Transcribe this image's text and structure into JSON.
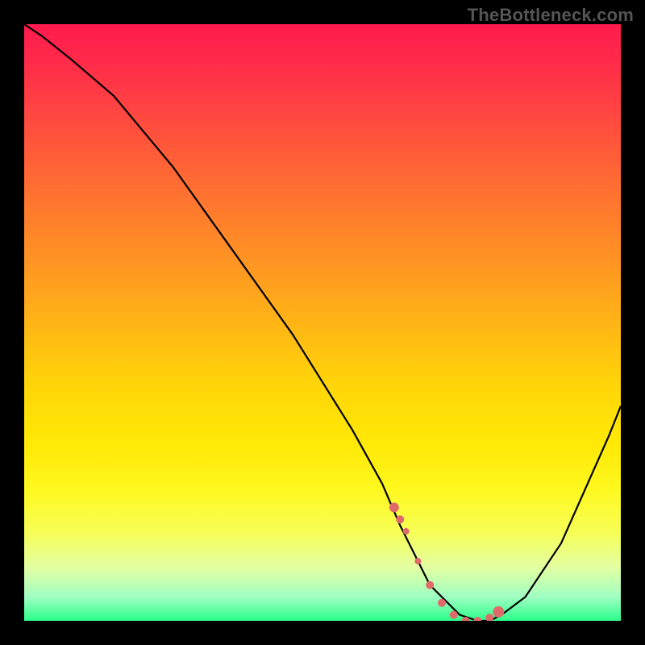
{
  "watermark": "TheBottleneck.com",
  "chart_data": {
    "type": "line",
    "title": "",
    "xlabel": "",
    "ylabel": "",
    "xlim": [
      0,
      100
    ],
    "ylim": [
      0,
      100
    ],
    "series": [
      {
        "name": "bottleneck-curve",
        "x": [
          0,
          3,
          8,
          15,
          25,
          35,
          45,
          55,
          60,
          63,
          66,
          68,
          71,
          73,
          76,
          78,
          80,
          84,
          90,
          98,
          100
        ],
        "values": [
          100,
          98,
          94,
          88,
          76,
          62,
          48,
          32,
          23,
          16,
          10,
          6,
          3,
          1,
          0,
          0,
          1,
          4,
          13,
          31,
          36
        ]
      }
    ],
    "markers": {
      "name": "highlight-dots",
      "color": "#e06a6a",
      "x": [
        62,
        63,
        64,
        66,
        68,
        70,
        72,
        74,
        76,
        78,
        79.5
      ],
      "values": [
        19,
        17,
        15,
        10,
        6,
        3,
        1,
        0,
        0,
        0.5,
        1.5
      ],
      "radii": [
        6,
        5,
        4,
        4,
        5,
        5,
        5,
        5,
        5,
        5,
        7
      ]
    },
    "gradient_stops": [
      {
        "pct": 0,
        "color": "#ff1a4d"
      },
      {
        "pct": 50,
        "color": "#ffb916"
      },
      {
        "pct": 80,
        "color": "#fff81f"
      },
      {
        "pct": 100,
        "color": "#2bff8a"
      }
    ]
  }
}
